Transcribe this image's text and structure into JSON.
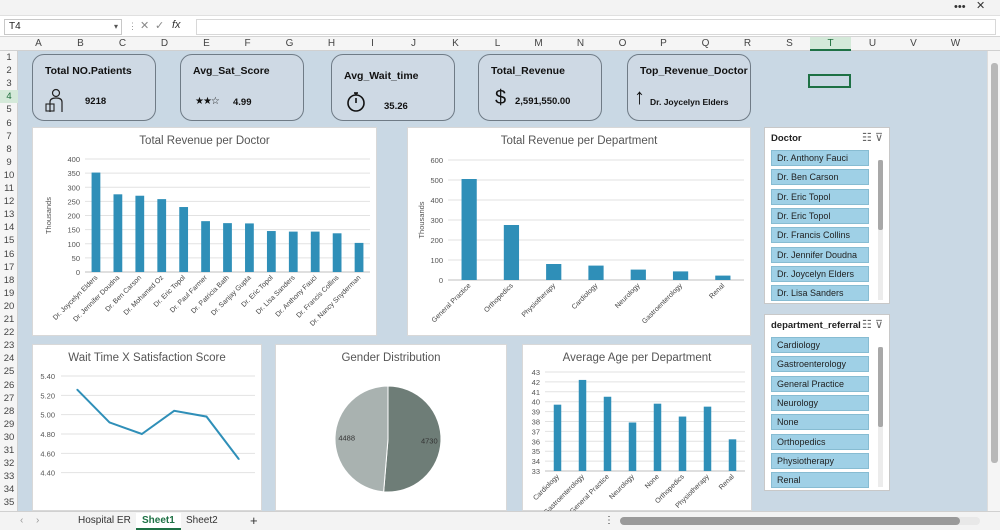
{
  "window": {
    "more_label": "•••",
    "minimize_label": "—",
    "maximize_label": "☐",
    "close_label": "✕"
  },
  "formula_bar": {
    "name_box": "T4",
    "cancel": "✕",
    "confirm": "✓",
    "fx": "fx",
    "formula": ""
  },
  "columns": [
    "A",
    "B",
    "C",
    "D",
    "E",
    "F",
    "G",
    "H",
    "I",
    "J",
    "K",
    "L",
    "M",
    "N",
    "O",
    "P",
    "Q",
    "R",
    "S",
    "T",
    "U",
    "V",
    "W"
  ],
  "selected_column": "T",
  "rows": [
    "1",
    "2",
    "3",
    "4",
    "5",
    "6",
    "7",
    "8",
    "9",
    "10",
    "11",
    "12",
    "13",
    "14",
    "15",
    "16",
    "17",
    "18",
    "19",
    "20",
    "21",
    "22",
    "23",
    "24",
    "25",
    "26",
    "27",
    "28",
    "29",
    "30",
    "31",
    "32",
    "33",
    "34",
    "35"
  ],
  "selected_row": "4",
  "kpis": {
    "patients": {
      "title": "Total NO.Patients",
      "value": "9218",
      "icon": "person-icon"
    },
    "sat": {
      "title": "Avg_Sat_Score",
      "value": "4.99",
      "stars": "★★☆",
      "icon": "star-rating-icon"
    },
    "wait": {
      "title": "Avg_Wait_time",
      "value": "35.26",
      "icon": "stopwatch-icon"
    },
    "revenue": {
      "title": "Total_Revenue",
      "value": "2,591,550.00",
      "symbol": "$",
      "icon": "dollar-icon"
    },
    "top_doctor": {
      "title": "Top_Revenue_Doctor",
      "value": "Dr. Joycelyn Elders",
      "arrow": "↑",
      "icon": "up-arrow-icon"
    }
  },
  "chart_data": [
    {
      "id": "rev_doctor",
      "type": "bar",
      "title": "Total Revenue per Doctor",
      "ylabel": "Thousands",
      "xlabel": "",
      "ylim": [
        0,
        400
      ],
      "yticks": [
        0,
        50,
        100,
        150,
        200,
        250,
        300,
        350,
        400
      ],
      "categories": [
        "Dr. Joycelyn Elders",
        "Dr. Jennifer Doudna",
        "Dr. Ben Carson",
        "Dr. Mohamed Oz",
        "Dr. Eric Topol",
        "Dr. Paul Farmer",
        "Dr. Patricia Bath",
        "Dr. Sanjay Gupta",
        "Dr. Eric Topol",
        "Dr. Lisa Sanders",
        "Dr. Anthony Fauci",
        "Dr. Francis Collins",
        "Dr. Nancy Snyderman"
      ],
      "values": [
        352,
        275,
        270,
        258,
        230,
        180,
        173,
        172,
        145,
        143,
        143,
        137,
        103
      ],
      "color": "#2f8fb8",
      "grid": true
    },
    {
      "id": "rev_dept",
      "type": "bar",
      "title": "Total Revenue per Department",
      "ylabel": "Thousands",
      "xlabel": "",
      "ylim": [
        0,
        600
      ],
      "yticks": [
        0,
        100,
        200,
        300,
        400,
        500,
        600
      ],
      "categories": [
        "General Practice",
        "Orthopedics",
        "Physiotherapy",
        "Cardiology",
        "Neurology",
        "Gastroenterology",
        "Renal"
      ],
      "values": [
        505,
        275,
        80,
        72,
        52,
        43,
        22
      ],
      "color": "#2f8fb8",
      "grid": true
    },
    {
      "id": "wait_sat",
      "type": "line",
      "title": "Wait Time X Satisfaction Score",
      "xlabel": "",
      "ylabel": "",
      "ylim": [
        4.2,
        5.4
      ],
      "yticks": [
        4.4,
        4.6,
        4.8,
        5.0,
        5.2,
        5.4
      ],
      "ytick_labels": [
        "4.40",
        "4.60",
        "4.80",
        "5.00",
        "5.20",
        "5.40"
      ],
      "x": [
        1,
        2,
        3,
        4,
        5,
        6
      ],
      "values": [
        5.26,
        4.92,
        4.8,
        5.04,
        4.98,
        4.54
      ],
      "color": "#2f8fb8",
      "grid": true
    },
    {
      "id": "gender",
      "type": "pie",
      "title": "Gender Distribution",
      "labels": [
        "4730",
        "4488"
      ],
      "values": [
        4730,
        4488
      ],
      "colors": [
        "#6e7d77",
        "#a9b2b0"
      ]
    },
    {
      "id": "age_dept",
      "type": "bar",
      "title": "Average Age per Department",
      "xlabel": "",
      "ylabel": "",
      "ylim": [
        33,
        43
      ],
      "yticks": [
        33,
        34,
        35,
        36,
        37,
        38,
        39,
        40,
        41,
        42,
        43
      ],
      "categories": [
        "Cardiology",
        "Gastroenterology",
        "General Practice",
        "Neurology",
        "None",
        "Orthopedics",
        "Physiotherapy",
        "Renal"
      ],
      "values": [
        39.7,
        42.2,
        40.5,
        37.9,
        39.8,
        38.5,
        39.5,
        36.2
      ],
      "color": "#2f8fb8",
      "grid": true
    }
  ],
  "slicers": {
    "doctor": {
      "title": "Doctor",
      "items": [
        "Dr. Anthony Fauci",
        "Dr. Ben Carson",
        "Dr. Eric Topol",
        "Dr. Eric Topol",
        "Dr. Francis Collins",
        "Dr. Jennifer Doudna",
        "Dr. Joycelyn Elders",
        "Dr. Lisa Sanders"
      ]
    },
    "department": {
      "title": "department_referral",
      "items": [
        "Cardiology",
        "Gastroenterology",
        "General Practice",
        "Neurology",
        "None",
        "Orthopedics",
        "Physiotherapy",
        "Renal"
      ]
    }
  },
  "sheets": {
    "nav_prev": "‹",
    "nav_next": "›",
    "tabs": [
      "Hospital ER",
      "Sheet1",
      "Sheet2"
    ],
    "active": "Sheet1",
    "add": "+",
    "more": "⋮"
  }
}
